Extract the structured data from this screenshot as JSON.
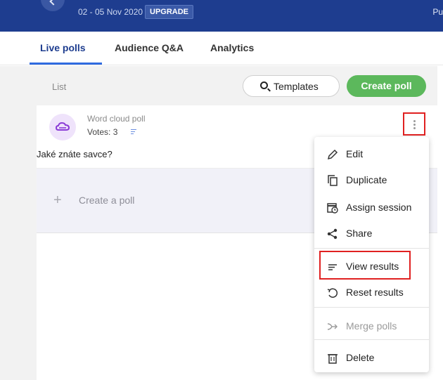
{
  "topbar": {
    "event_date": "02 - 05 Nov 2020",
    "upgrade_label": "UPGRADE",
    "right_text": "Pu"
  },
  "tabs": [
    {
      "label": "Live polls",
      "active": true
    },
    {
      "label": "Audience Q&A",
      "active": false
    },
    {
      "label": "Analytics",
      "active": false
    }
  ],
  "toolbar": {
    "list_label": "List",
    "templates_label": "Templates",
    "create_poll_label": "Create poll"
  },
  "poll": {
    "type": "Word cloud poll",
    "votes": "Votes: 3",
    "question": "Jaké znáte savce?"
  },
  "create_row": {
    "label": "Create a poll"
  },
  "menu": {
    "items": [
      {
        "label": "Edit",
        "icon": "pencil-icon"
      },
      {
        "label": "Duplicate",
        "icon": "duplicate-icon"
      },
      {
        "label": "Assign session",
        "icon": "calendar-clock-icon"
      },
      {
        "label": "Share",
        "icon": "share-icon"
      },
      {
        "label": "View results",
        "icon": "results-lines-icon"
      },
      {
        "label": "Reset results",
        "icon": "reset-icon"
      },
      {
        "label": "Merge polls",
        "icon": "merge-icon",
        "disabled": true
      },
      {
        "label": "Delete",
        "icon": "trash-icon"
      }
    ]
  },
  "colors": {
    "topbar": "#1e3d8f",
    "accent_blue": "#2f6be0",
    "create_green": "#5cb85c",
    "highlight_red": "#e02020",
    "poll_icon_purple": "#8a3ad6"
  }
}
